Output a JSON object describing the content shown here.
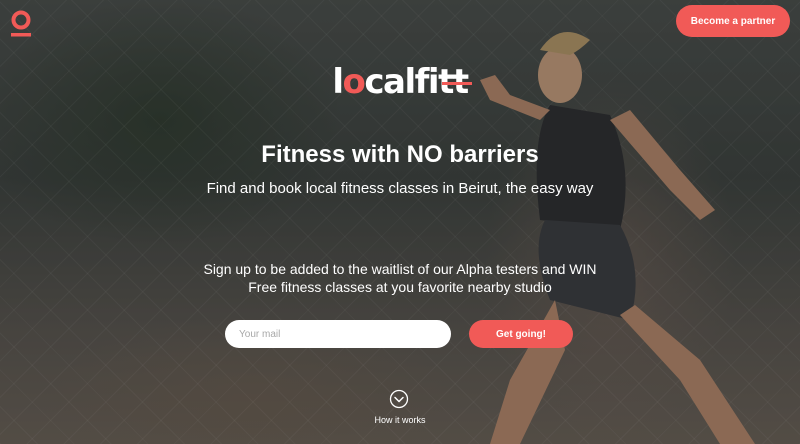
{
  "header": {
    "logo_icon": "localfitt-pin-icon",
    "partner_button_label": "Become a partner"
  },
  "brand": {
    "name_before": "l",
    "name_accent": "o",
    "name_after": "calfitt"
  },
  "hero": {
    "headline": "Fitness with NO barriers",
    "subheadline": "Find and book local fitness classes in Beirut, the easy way",
    "waitlist_line1": "Sign up to be added to the waitlist of our Alpha testers and WIN",
    "waitlist_line2": "Free fitness classes at you favorite nearby studio"
  },
  "signup": {
    "email_placeholder": "Your mail",
    "email_value": "",
    "submit_label": "Get going!"
  },
  "footer_hint": {
    "icon": "chevron-down-circle-icon",
    "label": "How it works"
  },
  "colors": {
    "accent": "#f15a57",
    "text": "#ffffff"
  }
}
